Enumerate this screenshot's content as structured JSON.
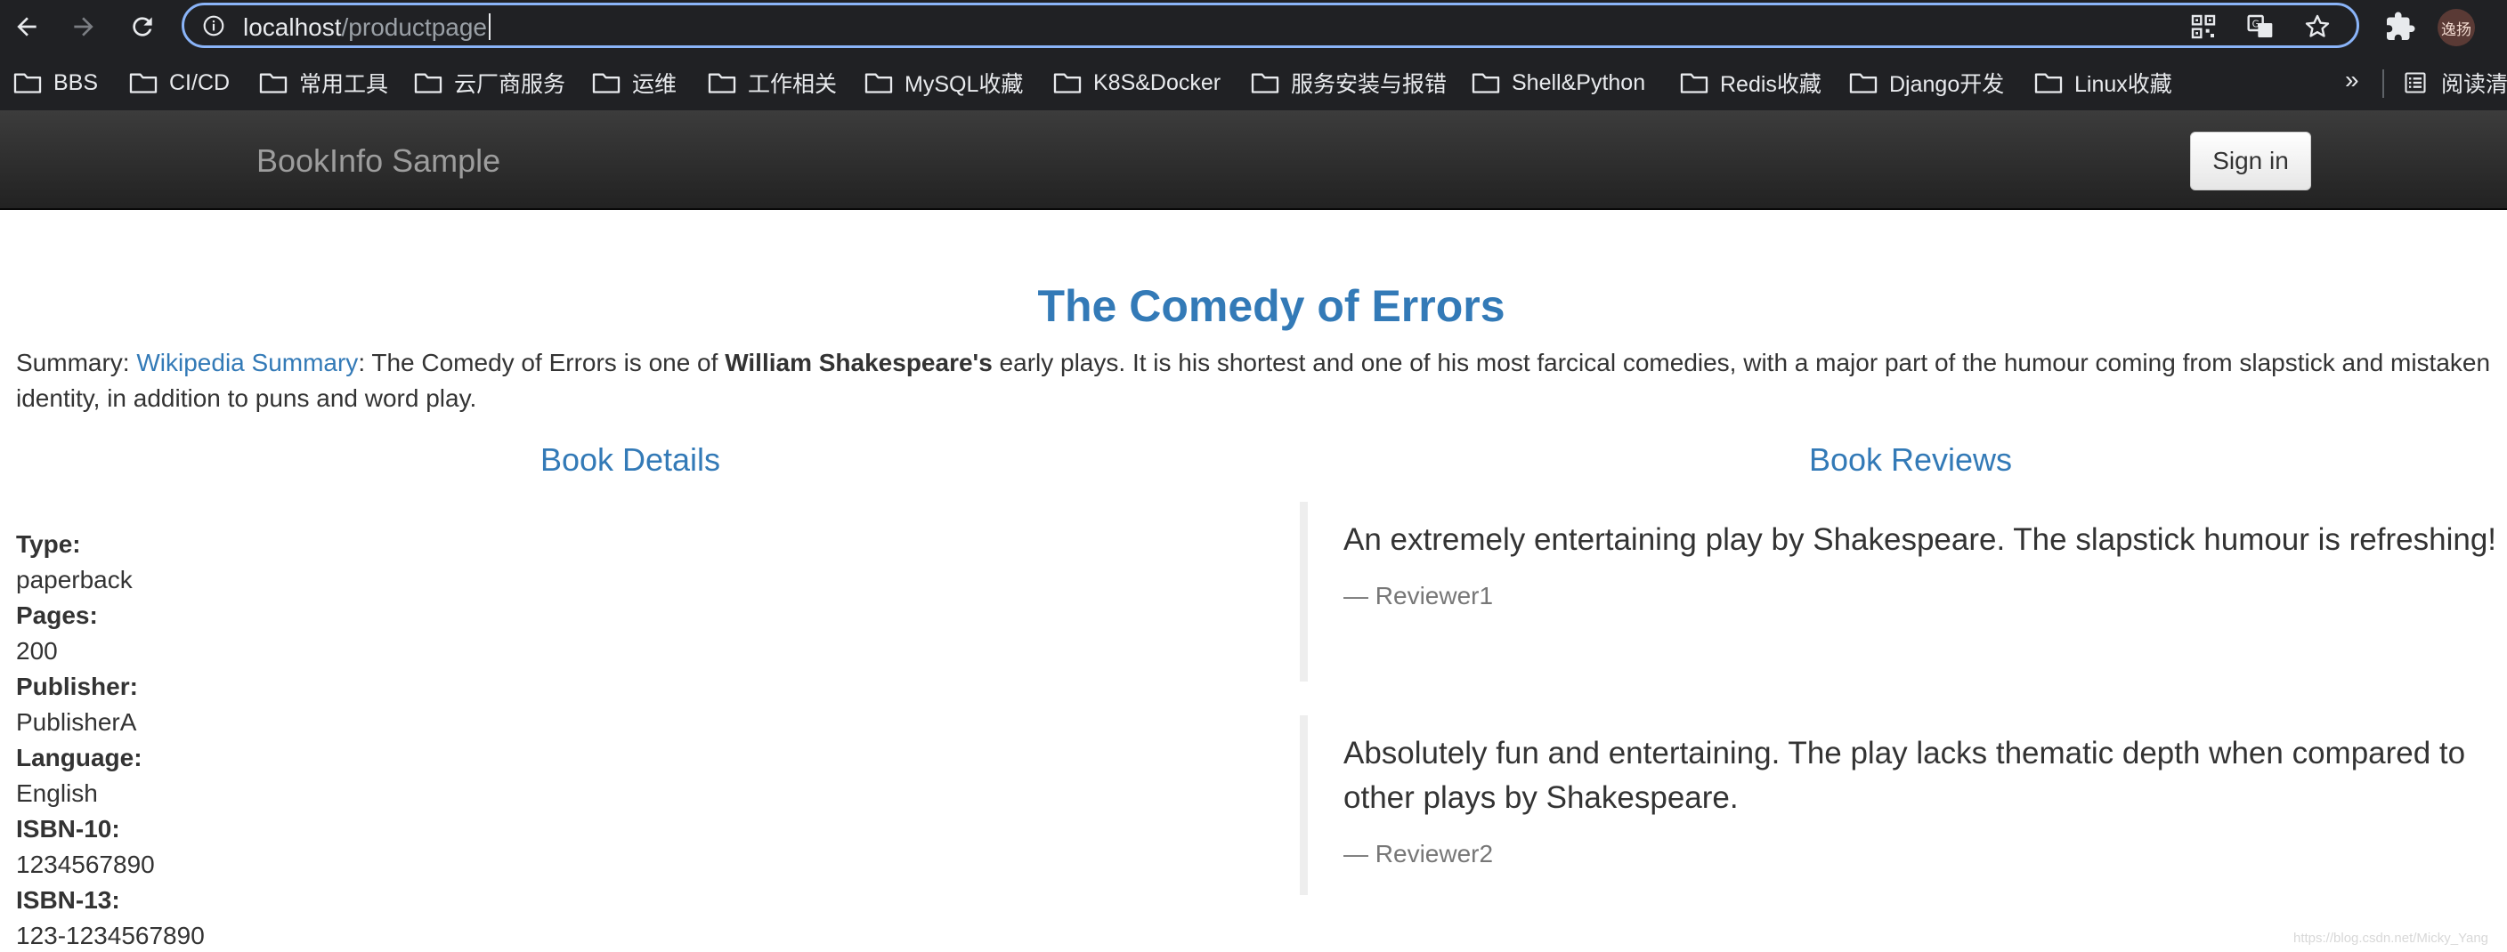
{
  "browser": {
    "url_host": "localhost",
    "url_path": "/productpage",
    "avatar_text": "逸扬",
    "bookmarks": [
      "BBS",
      "CI/CD",
      "常用工具",
      "云厂商服务",
      "运维",
      "工作相关",
      "MySQL收藏",
      "K8S&Docker",
      "服务安装与报错",
      "Shell&Python",
      "Redis收藏",
      "Django开发",
      "Linux收藏"
    ],
    "more_label": "»",
    "reading_list_label": "阅读清"
  },
  "navbar": {
    "brand": "BookInfo Sample",
    "signin_label": "Sign in"
  },
  "product": {
    "title": "The Comedy of Errors",
    "summary_prefix": "Summary: ",
    "summary_link": "Wikipedia Summary",
    "summary_mid": ": The Comedy of Errors is one of ",
    "summary_bold": "William Shakespeare's",
    "summary_rest": " early plays. It is his shortest and one of his most farcical comedies, with a major part of the humour coming from slapstick and mistaken identity, in addition to puns and word play."
  },
  "details": {
    "heading": "Book Details",
    "items": [
      {
        "label": "Type:",
        "value": "paperback"
      },
      {
        "label": "Pages:",
        "value": "200"
      },
      {
        "label": "Publisher:",
        "value": "PublisherA"
      },
      {
        "label": "Language:",
        "value": "English"
      },
      {
        "label": "ISBN-10:",
        "value": "1234567890"
      },
      {
        "label": "ISBN-13:",
        "value": "123-1234567890"
      }
    ]
  },
  "reviews": {
    "heading": "Book Reviews",
    "items": [
      {
        "text": "An extremely entertaining play by Shakespeare. The slapstick humour is refreshing!",
        "reviewer": "— Reviewer1"
      },
      {
        "text": "Absolutely fun and entertaining. The play lacks thematic depth when compared to other plays by Shakespeare.",
        "reviewer": "— Reviewer2"
      }
    ]
  },
  "watermark": "https://blog.csdn.net/Micky_Yang"
}
